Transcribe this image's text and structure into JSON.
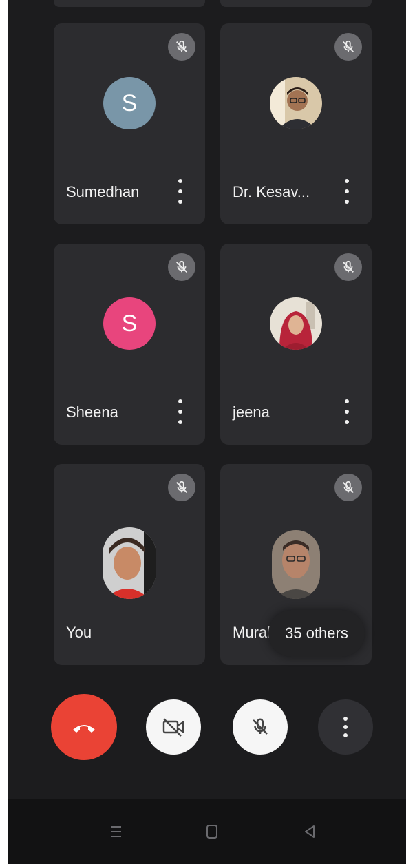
{
  "participants": [
    {
      "name": "Sumedhan",
      "avatar_type": "letter",
      "initial": "S",
      "avatar_color": "#7996a8",
      "muted": true
    },
    {
      "name": "Dr. Kesav...",
      "avatar_type": "photo",
      "muted": true
    },
    {
      "name": "Sheena",
      "avatar_type": "letter",
      "initial": "S",
      "avatar_color": "#e8457d",
      "muted": true
    },
    {
      "name": "jeena",
      "avatar_type": "photo",
      "muted": true
    },
    {
      "name": "You",
      "avatar_type": "photo",
      "muted": true
    },
    {
      "name": "Mural",
      "avatar_type": "photo",
      "muted": true
    }
  ],
  "others_count_label": "35 others",
  "controls": {
    "end_call_icon": "phone-hangup-icon",
    "camera_icon": "camera-off-icon",
    "mic_icon": "mic-off-icon",
    "more_icon": "more-vert-icon"
  },
  "navigation": {
    "recents_icon": "recents-icon",
    "home_icon": "home-icon",
    "back_icon": "back-icon"
  },
  "colors": {
    "background": "#1c1c1e",
    "tile": "#2c2c2f",
    "end_call": "#ea4335",
    "mute_badge": "#6b6b6f"
  }
}
